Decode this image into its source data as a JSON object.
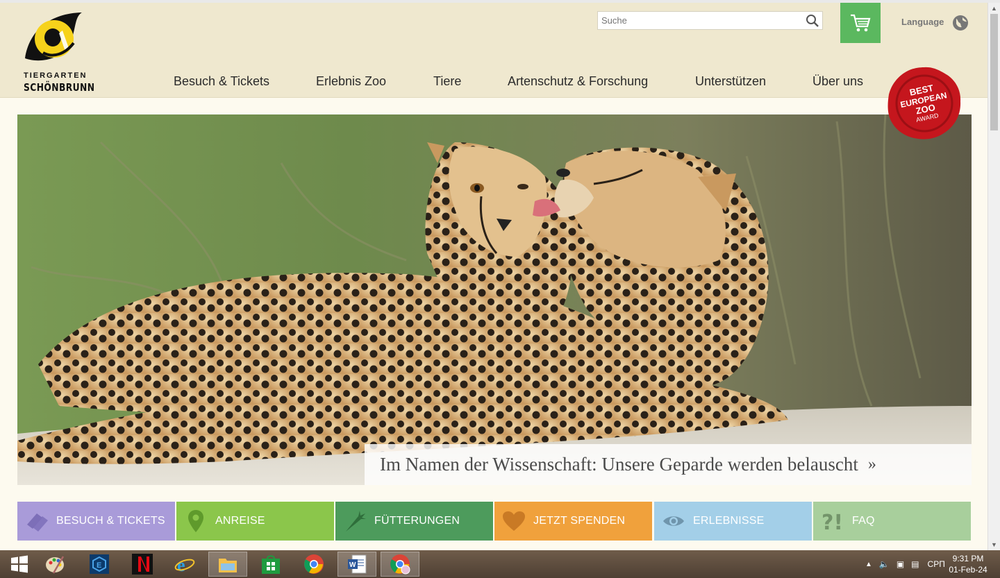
{
  "logo": {
    "line1": "TIERGARTEN",
    "line2": "SCHÖNBRUNN"
  },
  "search": {
    "placeholder": "Suche",
    "icon": "search-icon"
  },
  "cart": {
    "icon": "cart-icon"
  },
  "language": {
    "label": "Language",
    "icon": "globe-icon"
  },
  "nav": [
    {
      "label": "Besuch & Tickets"
    },
    {
      "label": "Erlebnis Zoo"
    },
    {
      "label": "Tiere"
    },
    {
      "label": "Artenschutz & Forschung"
    },
    {
      "label": "Unterstützen"
    },
    {
      "label": "Über uns"
    }
  ],
  "award": {
    "line1": "BEST",
    "line2": "EUROPEAN",
    "line3": "ZOO",
    "line4": "AWARD"
  },
  "hero": {
    "caption": "Im Namen der Wissenschaft: Unsere Geparde werden belauscht",
    "arrow": "»"
  },
  "quick_links": [
    {
      "label": "BESUCH & TICKETS",
      "icon": "tickets-icon",
      "color": "#a99bd9"
    },
    {
      "label": "ANREISE",
      "icon": "location-pin-icon",
      "color": "#8bc64b"
    },
    {
      "label": "FÜTTERUNGEN",
      "icon": "carrot-icon",
      "color": "#4d9b5c"
    },
    {
      "label": "JETZT SPENDEN",
      "icon": "heart-icon",
      "color": "#f0a13c"
    },
    {
      "label": "ERLEBNISSE",
      "icon": "eye-icon",
      "color": "#a3cfe8"
    },
    {
      "label": "FAQ",
      "icon": "question-exclamation-icon",
      "color": "#a8cf9c"
    }
  ],
  "taskbar": {
    "apps": [
      "windows-start-icon",
      "paint-icon",
      "security-app-icon",
      "netflix-icon",
      "internet-explorer-icon",
      "file-explorer-icon",
      "store-icon",
      "chrome-icon",
      "word-icon",
      "chrome-profile-icon"
    ],
    "tray": {
      "language": "СРП",
      "time": "9:31 PM",
      "date": "01-Feb-24"
    }
  }
}
